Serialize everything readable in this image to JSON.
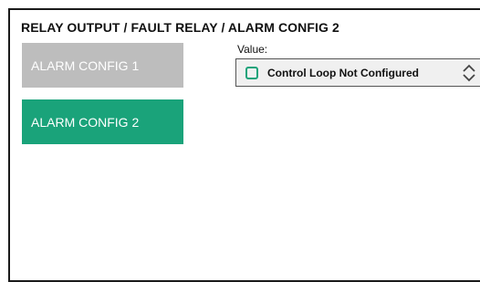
{
  "header": {
    "title": "RELAY OUTPUT / FAULT RELAY / ALARM CONFIG 2"
  },
  "nav": {
    "items": [
      {
        "label": "ALARM CONFIG 1",
        "state": "inactive"
      },
      {
        "label": "ALARM CONFIG 2",
        "state": "active"
      }
    ]
  },
  "value_field": {
    "label": "Value:",
    "selected": "Control Loop Not Configured",
    "status_icon": "square-outline-icon",
    "spinner_icon": "up-down-chevron-icon"
  },
  "colors": {
    "accent": "#1aa37a",
    "inactive": "#bdbdbd",
    "field_bg": "#f0f0f0"
  }
}
